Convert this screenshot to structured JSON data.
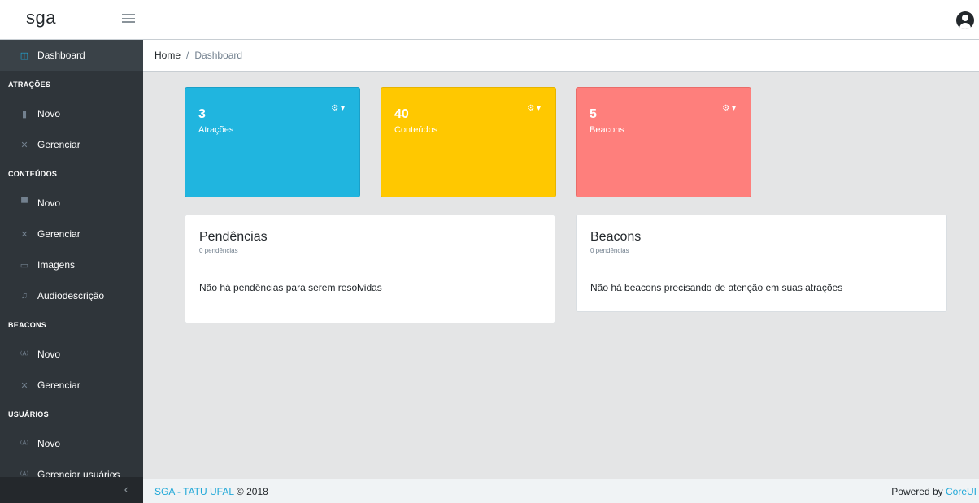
{
  "header": {
    "brand": "sga"
  },
  "breadcrumb": {
    "home": "Home",
    "separator": "/",
    "current": "Dashboard"
  },
  "sidebar": {
    "dashboard": "Dashboard",
    "sections": [
      {
        "title": "ATRAÇÕES",
        "items": [
          "Novo",
          "Gerenciar"
        ]
      },
      {
        "title": "CONTEÚDOS",
        "items": [
          "Novo",
          "Gerenciar",
          "Imagens",
          "Audiodescrição"
        ]
      },
      {
        "title": "BEACONS",
        "items": [
          "Novo",
          "Gerenciar"
        ]
      },
      {
        "title": "USUÁRIOS",
        "items": [
          "Novo",
          "Gerenciar usuários"
        ]
      }
    ],
    "minimizer": "‹"
  },
  "stats": [
    {
      "value": "3",
      "label": "Atrações",
      "color": "#20b5df"
    },
    {
      "value": "40",
      "label": "Conteúdos",
      "color": "#ffc800"
    },
    {
      "value": "5",
      "label": "Beacons",
      "color": "#fe7f7c"
    }
  ],
  "cards": [
    {
      "title": "Pendências",
      "subtitle": "0 pendências",
      "text": "Não há pendências para serem resolvidas"
    },
    {
      "title": "Beacons",
      "subtitle": "0 pendências",
      "text": "Não há beacons precisando de atenção em suas atrações"
    }
  ],
  "footer": {
    "link": "SGA - TATU UFAL",
    "copyright": "© 2018",
    "powered_by": "Powered by",
    "powered_link": "CoreUI"
  },
  "colors": {
    "accent": "#20a8d8",
    "sidebar_bg": "#2f353a"
  }
}
